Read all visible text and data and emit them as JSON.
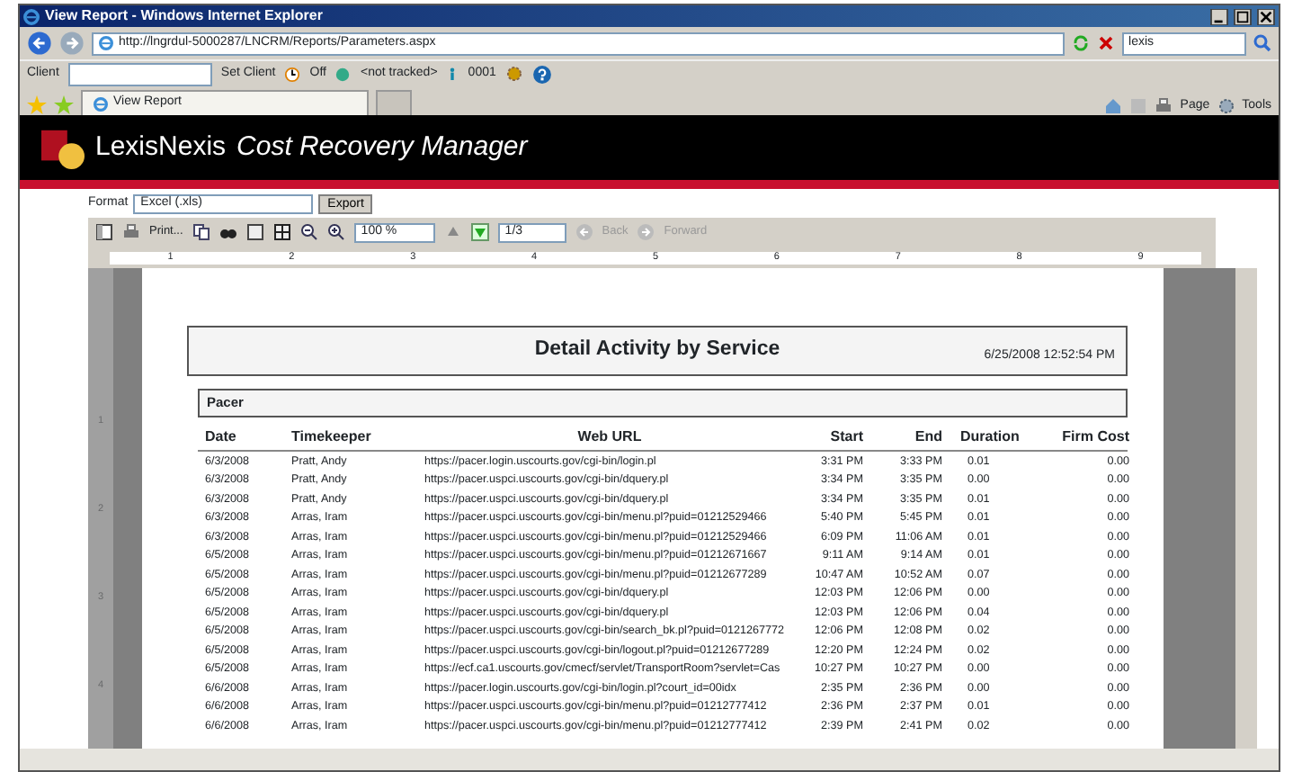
{
  "window": {
    "title": "View Report - Windows Internet Explorer"
  },
  "address_bar": {
    "url": "http://lngrdul-5000287/LNCRM/Reports/Parameters.aspx",
    "search": "lexis"
  },
  "command_bar": {
    "client_label": "Client",
    "set_client": "Set Client",
    "timer": "Off",
    "tracking": "<not tracked>",
    "matter": "0001"
  },
  "tabs": [
    {
      "label": "View Report",
      "selected": true
    },
    {
      "selected": false
    }
  ],
  "tools": {
    "page": "Page",
    "tools": "Tools"
  },
  "banner": {
    "brand": "LexisNexis",
    "product": "Cost Recovery Manager"
  },
  "export": {
    "label": "Format",
    "format": "Excel (.xls)",
    "button": "Export"
  },
  "viewer_toolbar": {
    "print": "Print...",
    "zoom": "100 %",
    "page": "1/3",
    "back": {
      "label": "Back",
      "disabled": true
    },
    "forward": {
      "label": "Forward",
      "disabled": true
    }
  },
  "ruler": {
    "h_marks": [
      "1",
      "2",
      "3",
      "4",
      "5",
      "6",
      "7",
      "8",
      "9"
    ],
    "v_marks": [
      "1",
      "2",
      "3",
      "4"
    ]
  },
  "report": {
    "title": "Detail Activity by Service",
    "timestamp": "6/25/2008 12:52:54 PM",
    "group": "Pacer",
    "columns": [
      "Date",
      "Timekeeper",
      "Web URL",
      "Start",
      "End",
      "Duration",
      "Firm Cost"
    ],
    "rows": [
      [
        "6/3/2008",
        "Pratt, Andy",
        "https://pacer.login.uscourts.gov/cgi-bin/login.pl",
        "3:31 PM",
        "3:33 PM",
        "0.01",
        "0.00"
      ],
      [
        "6/3/2008",
        "Pratt, Andy",
        "https://pacer.uspci.uscourts.gov/cgi-bin/dquery.pl",
        "3:34 PM",
        "3:35 PM",
        "0.00",
        "0.00"
      ],
      [
        "6/3/2008",
        "Pratt, Andy",
        "https://pacer.uspci.uscourts.gov/cgi-bin/dquery.pl",
        "3:34 PM",
        "3:35 PM",
        "0.01",
        "0.00"
      ],
      [
        "6/3/2008",
        "Arras, Iram",
        "https://pacer.uspci.uscourts.gov/cgi-bin/menu.pl?puid=01212529466",
        "5:40 PM",
        "5:45 PM",
        "0.01",
        "0.00"
      ],
      [
        "6/3/2008",
        "Arras, Iram",
        "https://pacer.uspci.uscourts.gov/cgi-bin/menu.pl?puid=01212529466",
        "6:09 PM",
        "11:06 AM",
        "0.01",
        "0.00"
      ],
      [
        "6/5/2008",
        "Arras, Iram",
        "https://pacer.uspci.uscourts.gov/cgi-bin/menu.pl?puid=01212671667",
        "9:11 AM",
        "9:14 AM",
        "0.01",
        "0.00"
      ],
      [
        "6/5/2008",
        "Arras, Iram",
        "https://pacer.uspci.uscourts.gov/cgi-bin/menu.pl?puid=01212677289",
        "10:47 AM",
        "10:52 AM",
        "0.07",
        "0.00"
      ],
      [
        "6/5/2008",
        "Arras, Iram",
        "https://pacer.uspci.uscourts.gov/cgi-bin/dquery.pl",
        "12:03 PM",
        "12:06 PM",
        "0.00",
        "0.00"
      ],
      [
        "6/5/2008",
        "Arras, Iram",
        "https://pacer.uspci.uscourts.gov/cgi-bin/dquery.pl",
        "12:03 PM",
        "12:06 PM",
        "0.04",
        "0.00"
      ],
      [
        "6/5/2008",
        "Arras, Iram",
        "https://pacer.uspci.uscourts.gov/cgi-bin/search_bk.pl?puid=0121267772",
        "12:06 PM",
        "12:08 PM",
        "0.02",
        "0.00"
      ],
      [
        "6/5/2008",
        "Arras, Iram",
        "https://pacer.uspci.uscourts.gov/cgi-bin/logout.pl?puid=01212677289",
        "12:20 PM",
        "12:24 PM",
        "0.02",
        "0.00"
      ],
      [
        "6/5/2008",
        "Arras, Iram",
        "https://ecf.ca1.uscourts.gov/cmecf/servlet/TransportRoom?servlet=Cas",
        "10:27 PM",
        "10:27 PM",
        "0.00",
        "0.00"
      ],
      [
        "6/6/2008",
        "Arras, Iram",
        "https://pacer.login.uscourts.gov/cgi-bin/login.pl?court_id=00idx",
        "2:35 PM",
        "2:36 PM",
        "0.00",
        "0.00"
      ],
      [
        "6/6/2008",
        "Arras, Iram",
        "https://pacer.uspci.uscourts.gov/cgi-bin/menu.pl?puid=01212777412",
        "2:36 PM",
        "2:37 PM",
        "0.01",
        "0.00"
      ],
      [
        "6/6/2008",
        "Arras, Iram",
        "https://pacer.uspci.uscourts.gov/cgi-bin/menu.pl?puid=01212777412",
        "2:39 PM",
        "2:41 PM",
        "0.02",
        "0.00"
      ]
    ]
  }
}
